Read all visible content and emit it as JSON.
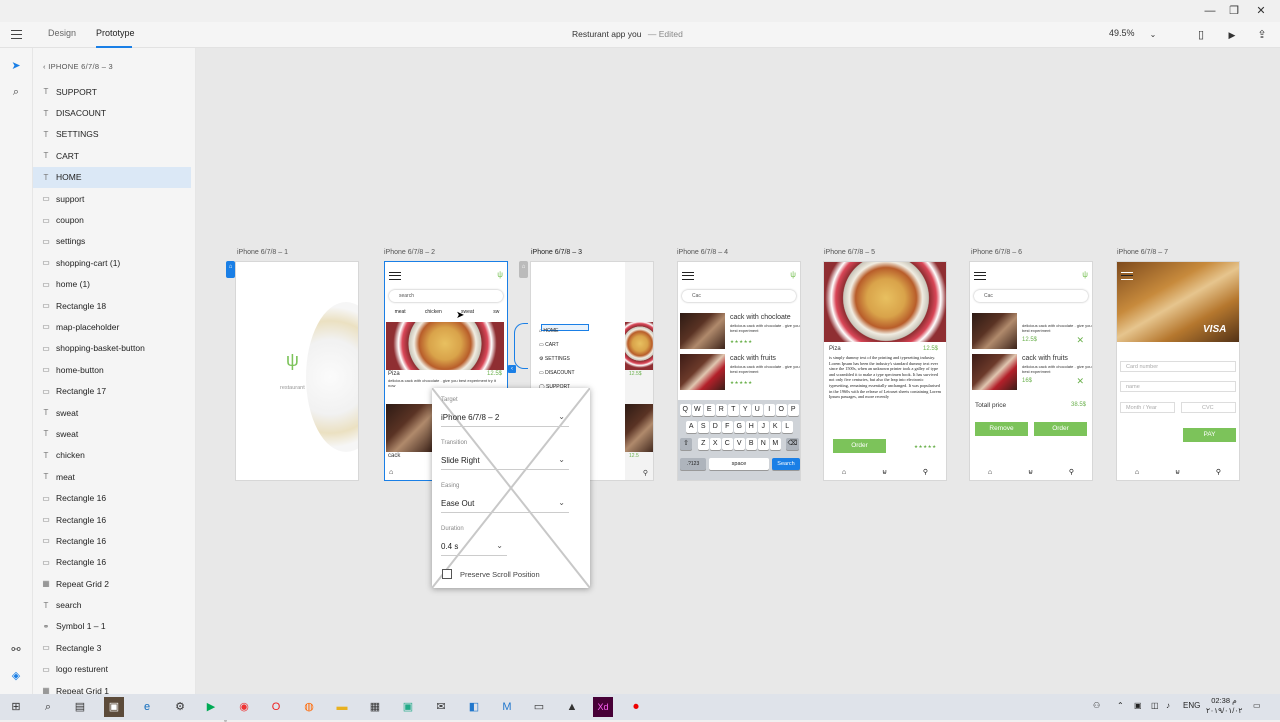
{
  "window_controls": {
    "minimize": "—",
    "maximize": "❐",
    "close": "✕"
  },
  "topbar": {
    "tabs": [
      {
        "label": "Design"
      },
      {
        "label": "Prototype"
      }
    ],
    "doc_title": "Resturant app you",
    "doc_status": "— Edited",
    "zoom": "49.5%"
  },
  "layers": {
    "artboard": "IPHONE 6/7/8 – 3",
    "items": [
      {
        "label": "SUPPORT",
        "icon": "T"
      },
      {
        "label": "DISACOUNT",
        "icon": "T"
      },
      {
        "label": "SETTINGS",
        "icon": "T"
      },
      {
        "label": "CART",
        "icon": "T"
      },
      {
        "label": "HOME",
        "icon": "T"
      },
      {
        "label": "support",
        "icon": "▭"
      },
      {
        "label": "coupon",
        "icon": "▭"
      },
      {
        "label": "settings",
        "icon": "▭"
      },
      {
        "label": "shopping-cart (1)",
        "icon": "▭"
      },
      {
        "label": "home (1)",
        "icon": "▭"
      },
      {
        "label": "Rectangle 18",
        "icon": "▭"
      },
      {
        "label": "map-placeholder",
        "icon": "▭"
      },
      {
        "label": "shopping-basket-button",
        "icon": "▭"
      },
      {
        "label": "home-button",
        "icon": "▭"
      },
      {
        "label": "Rectangle 17",
        "icon": "▭"
      },
      {
        "label": "sweat",
        "icon": "T"
      },
      {
        "label": "sweat",
        "icon": "T"
      },
      {
        "label": "chicken",
        "icon": "T"
      },
      {
        "label": "meat",
        "icon": "T"
      },
      {
        "label": "Rectangle 16",
        "icon": "▭"
      },
      {
        "label": "Rectangle 16",
        "icon": "▭"
      },
      {
        "label": "Rectangle 16",
        "icon": "▭"
      },
      {
        "label": "Rectangle 16",
        "icon": "▭"
      },
      {
        "label": "Repeat Grid 2",
        "icon": "▦"
      },
      {
        "label": "search",
        "icon": "T"
      },
      {
        "label": "Symbol 1 – 1",
        "icon": "⚭"
      },
      {
        "label": "Rectangle 3",
        "icon": "▭"
      },
      {
        "label": "logo resturent",
        "icon": "▭"
      },
      {
        "label": "Repeat Grid 1",
        "icon": "▦"
      }
    ]
  },
  "artboards": [
    {
      "label": "iPhone 6/7/8 – 1"
    },
    {
      "label": "iPhone 6/7/8 – 2"
    },
    {
      "label": "iPhone 6/7/8 – 3"
    },
    {
      "label": "iPhone 6/7/8 – 4"
    },
    {
      "label": "iPhone 6/7/8 – 5"
    },
    {
      "label": "iPhone 6/7/8 – 6"
    },
    {
      "label": "iPhone 6/7/8 – 7"
    }
  ],
  "screens": {
    "splash": {
      "logo_text": "restaurant"
    },
    "home": {
      "search": "search",
      "categories": [
        "meat",
        "chicken",
        "sweat",
        "sw"
      ],
      "item1": {
        "name": "Piza",
        "price": "12.5$",
        "desc": "delicious cack with chocolate . give you best experiment try it now"
      },
      "item2": {
        "name": "cack",
        "price": "12.5"
      }
    },
    "menu": {
      "items": [
        "HOME",
        "CART",
        "SETTINGS",
        "DISACOUNT",
        "SUPPORT"
      ],
      "price1": "12.5$",
      "price2": "12.5"
    },
    "search": {
      "query": "Cac",
      "results": [
        {
          "title": "cack with chocloate",
          "desc": "delicious cack with chocolate . give you best experiment"
        },
        {
          "title": "cack with fruits",
          "desc": "delicious cack with chocolate . give you best experiment"
        }
      ],
      "keys_row1": [
        "Q",
        "W",
        "E",
        "R",
        "T",
        "Y",
        "U",
        "I",
        "O",
        "P"
      ],
      "keys_row2": [
        "A",
        "S",
        "D",
        "F",
        "G",
        "H",
        "J",
        "K",
        "L"
      ],
      "keys_row3": [
        "Z",
        "X",
        "C",
        "V",
        "B",
        "N",
        "M"
      ],
      "key_num": ".?123",
      "key_space": "space",
      "key_search": "Search"
    },
    "detail": {
      "name": "Piza",
      "price": "12.5$",
      "desc": "is simply dummy text of the printing and typesetting industry. Lorem Ipsum has been the industry's standard dummy text ever since the 1500s, when an unknown printer took a galley of type and scrambled it to make a type specimen book. It has survived not only five centuries, but also the leap into electronic typesetting, remaining essentially unchanged. It was popularised in the 1960s with the release of Letraset sheets containing Lorem Ipsum passages, and more recently",
      "order": "Order"
    },
    "cart": {
      "search": "Cac",
      "items": [
        {
          "desc": "delicious cack with chocolate . give you best experiment",
          "price": "12.5$"
        },
        {
          "title": "cack with fruits",
          "desc": "delicious cack with chocolate . give you best experiment",
          "price": "16$"
        }
      ],
      "total_label": "Totall price",
      "total_value": "38.5$",
      "remove": "Remove",
      "order": "Order"
    },
    "payment": {
      "card_number": "Card number",
      "name": "name",
      "month_year": "Month / Year",
      "cvc": "CVC",
      "pay": "PAY",
      "brand": "VISA"
    }
  },
  "popup": {
    "target_label": "Target",
    "target_value": "iPhone 6/7/8 – 2",
    "transition_label": "Transition",
    "transition_value": "Slide Right",
    "easing_label": "Easing",
    "easing_value": "Ease Out",
    "duration_label": "Duration",
    "duration_value": "0.4 s",
    "preserve_label": "Preserve Scroll Position"
  },
  "taskbar": {
    "lang": "ENG",
    "time": "02:38 م",
    "date": "٢٠١٩/٠١/٠٢"
  },
  "colors": {
    "accent": "#1a7fe6",
    "green": "#7cc35a",
    "selection": "#dbe8f6",
    "xd": "#470137"
  }
}
